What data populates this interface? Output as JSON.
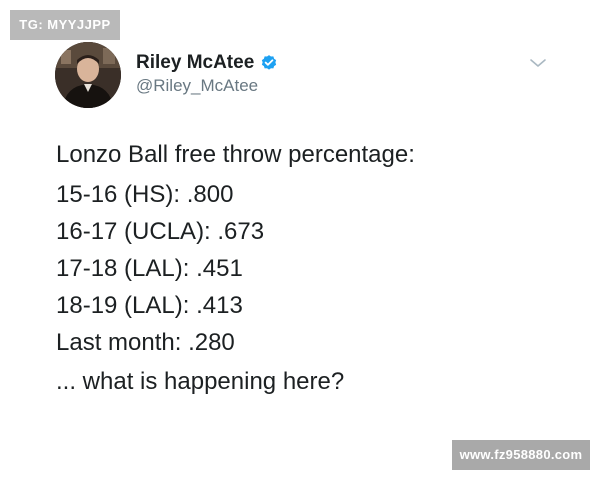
{
  "watermark_top": "TG: MYYJJPP",
  "watermark_bottom": "www.fz958880.com",
  "tweet": {
    "author": {
      "display_name": "Riley McAtee",
      "handle": "@Riley_McAtee",
      "verified": true
    },
    "icons": {
      "verified": "verified-badge-icon",
      "menu": "chevron-down-icon"
    },
    "body": {
      "intro": "Lonzo Ball free throw percentage:",
      "stats": [
        "15-16 (HS): .800",
        "16-17 (UCLA): .673",
        "17-18 (LAL): .451",
        "18-19 (LAL): .413",
        "Last month: .280"
      ],
      "closing": "... what is happening here?"
    }
  },
  "colors": {
    "text": "#1c2022",
    "secondary_text": "#697882",
    "verified_blue": "#1da1f2",
    "watermark_gray": "#b9b9b9"
  }
}
